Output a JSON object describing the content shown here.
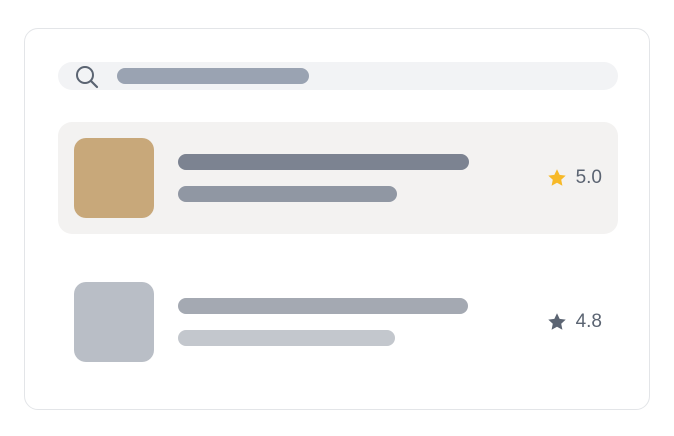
{
  "search": {
    "icon": "search-icon",
    "icon_color": "#5b6472",
    "placeholder_bar_color": "#9aa3b2"
  },
  "items": [
    {
      "selected": true,
      "thumbnail_color": "#c8a87a",
      "title_bar_color": "#7c8391",
      "subtitle_bar_color": "#9097a3",
      "star_icon": "star-icon",
      "star_color": "#f7b928",
      "rating": "5.0"
    },
    {
      "selected": false,
      "thumbnail_color": "#b9bec6",
      "title_bar_color": "#a4a9b2",
      "subtitle_bar_color": "#c3c7cd",
      "star_icon": "star-icon",
      "star_color": "#5b6472",
      "rating": "4.8"
    }
  ]
}
